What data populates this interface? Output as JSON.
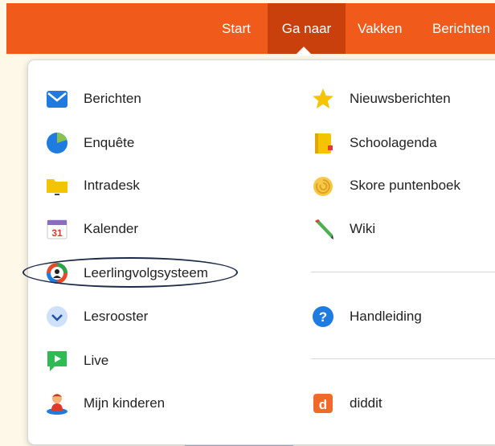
{
  "navbar": {
    "items": [
      {
        "label": "Start"
      },
      {
        "label": "Ga naar"
      },
      {
        "label": "Vakken"
      },
      {
        "label": "Berichten"
      }
    ],
    "color": "#f05a1a",
    "active_color": "#c9400c"
  },
  "menu": {
    "left": [
      {
        "label": "Berichten",
        "icon": "mail-icon"
      },
      {
        "label": "Enquête",
        "icon": "pie-chart-icon"
      },
      {
        "label": "Intradesk",
        "icon": "folder-icon"
      },
      {
        "label": "Kalender",
        "icon": "calendar-icon",
        "icon_text": "31"
      },
      {
        "label": "Leerlingvolgsysteem",
        "icon": "student-tracking-icon"
      },
      {
        "label": "Lesrooster",
        "icon": "chevron-down-icon"
      },
      {
        "label": "Live",
        "icon": "play-icon"
      },
      {
        "label": "Mijn kinderen",
        "icon": "child-icon"
      }
    ],
    "right": [
      {
        "label": "Nieuwsberichten",
        "icon": "star-icon"
      },
      {
        "label": "Schoolagenda",
        "icon": "notebook-icon"
      },
      {
        "label": "Skore puntenboek",
        "icon": "shell-icon"
      },
      {
        "label": "Wiki",
        "icon": "pencil-icon"
      },
      {
        "label": "Handleiding",
        "icon": "help-icon"
      },
      {
        "label": "diddit",
        "icon": "diddit-icon",
        "icon_text": "d"
      }
    ]
  }
}
